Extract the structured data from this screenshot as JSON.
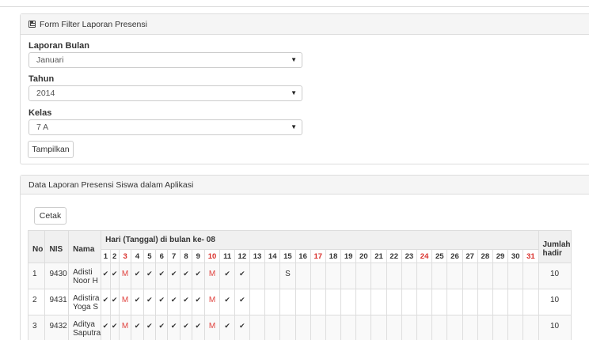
{
  "filter_panel": {
    "title": "Form Filter Laporan Presensi",
    "month_label": "Laporan Bulan",
    "month_value": "Januari",
    "year_label": "Tahun",
    "year_value": "2014",
    "class_label": "Kelas",
    "class_value": "7 A",
    "show_button": "Tampilkan"
  },
  "data_panel": {
    "title": "Data Laporan Presensi Siswa dalam Aplikasi",
    "print_button": "Cetak"
  },
  "table": {
    "col_no": "No",
    "col_nis": "NIS",
    "col_nama": "Nama",
    "col_days_header": "Hari (Tanggal) di bulan ke- 08",
    "col_total": "Jumlah hadir",
    "days": [
      "1",
      "2",
      "3",
      "4",
      "5",
      "6",
      "7",
      "8",
      "9",
      "10",
      "11",
      "12",
      "13",
      "14",
      "15",
      "16",
      "17",
      "18",
      "19",
      "20",
      "21",
      "22",
      "23",
      "24",
      "25",
      "26",
      "27",
      "28",
      "29",
      "30",
      "31"
    ],
    "red_days": [
      "3",
      "10",
      "17",
      "24",
      "31"
    ],
    "rows": [
      {
        "no": "1",
        "nis": "9430",
        "nama": "Adisti Noor H",
        "marks": [
          "✔",
          "✔",
          "M",
          "✔",
          "✔",
          "✔",
          "✔",
          "✔",
          "✔",
          "M",
          "✔",
          "✔",
          "",
          "",
          "S",
          "",
          "",
          "",
          "",
          "",
          "",
          "",
          "",
          "",
          "",
          "",
          "",
          "",
          "",
          "",
          ""
        ],
        "total": "10"
      },
      {
        "no": "2",
        "nis": "9431",
        "nama": "Adistira Yoga S",
        "marks": [
          "✔",
          "✔",
          "M",
          "✔",
          "✔",
          "✔",
          "✔",
          "✔",
          "✔",
          "M",
          "✔",
          "✔",
          "",
          "",
          "",
          "",
          "",
          "",
          "",
          "",
          "",
          "",
          "",
          "",
          "",
          "",
          "",
          "",
          "",
          "",
          ""
        ],
        "total": "10"
      },
      {
        "no": "3",
        "nis": "9432",
        "nama": "Aditya Saputra",
        "marks": [
          "✔",
          "✔",
          "M",
          "✔",
          "✔",
          "✔",
          "✔",
          "✔",
          "✔",
          "M",
          "✔",
          "✔",
          "",
          "",
          "",
          "",
          "",
          "",
          "",
          "",
          "",
          "",
          "",
          "",
          "",
          "",
          "",
          "",
          "",
          "",
          ""
        ],
        "total": "10"
      }
    ]
  }
}
